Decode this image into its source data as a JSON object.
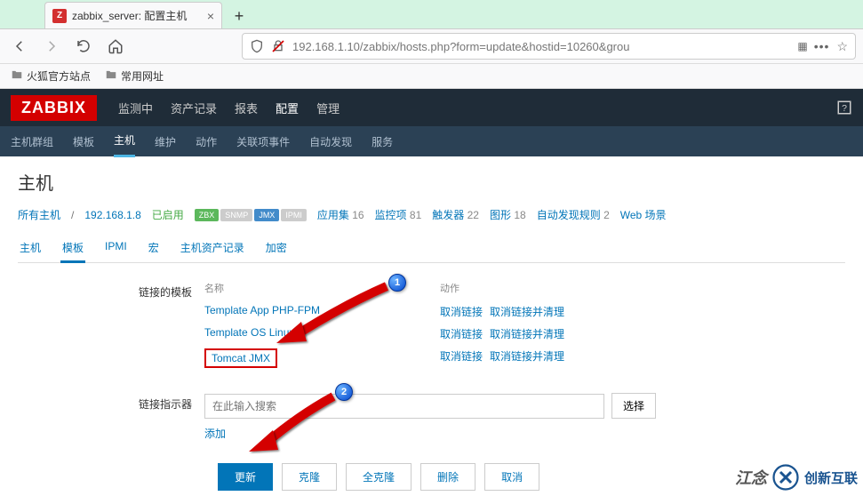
{
  "browser": {
    "tab_title": "zabbix_server: 配置主机",
    "favicon_text": "Z",
    "url": "192.168.1.10/zabbix/hosts.php?form=update&hostid=10260&grou",
    "bookmarks": [
      "火狐官方站点",
      "常用网址"
    ]
  },
  "zabbix": {
    "logo": "ZABBIX",
    "main_nav": [
      "监测中",
      "资产记录",
      "报表",
      "配置",
      "管理"
    ],
    "main_nav_active": 3,
    "sub_nav": [
      "主机群组",
      "模板",
      "主机",
      "维护",
      "动作",
      "关联项事件",
      "自动发现",
      "服务"
    ],
    "sub_nav_active": 2,
    "page_title": "主机",
    "breadcrumb": {
      "all_hosts": "所有主机",
      "host_ip": "192.168.1.8",
      "status": "已启用",
      "badges": {
        "zbx": "ZBX",
        "snmp": "SNMP",
        "jmx": "JMX",
        "ipmi": "IPMI"
      },
      "counts": [
        {
          "label": "应用集",
          "value": "16"
        },
        {
          "label": "监控项",
          "value": "81"
        },
        {
          "label": "触发器",
          "value": "22"
        },
        {
          "label": "图形",
          "value": "18"
        },
        {
          "label": "自动发现规则",
          "value": "2"
        },
        {
          "label": "Web 场景",
          "value": ""
        }
      ]
    },
    "detail_tabs": [
      "主机",
      "模板",
      "IPMI",
      "宏",
      "主机资产记录",
      "加密"
    ],
    "detail_tab_active": 1,
    "form": {
      "linked_label": "链接的模板",
      "name_header": "名称",
      "action_header": "动作",
      "templates": [
        {
          "name": "Template App PHP-FPM",
          "highlight": false
        },
        {
          "name": "Template OS Linux",
          "highlight": false
        },
        {
          "name": "Tomcat JMX",
          "highlight": true
        }
      ],
      "unlink": "取消链接",
      "unlink_clear": "取消链接并清理",
      "indicator_label": "链接指示器",
      "search_placeholder": "在此输入搜索",
      "select_btn": "选择",
      "add_link": "添加"
    },
    "buttons": {
      "update": "更新",
      "clone": "克隆",
      "full_clone": "全克隆",
      "delete": "删除",
      "cancel": "取消"
    }
  },
  "callouts": {
    "one": "1",
    "two": "2"
  },
  "watermark": {
    "text1": "江念",
    "text2": "创新互联"
  }
}
